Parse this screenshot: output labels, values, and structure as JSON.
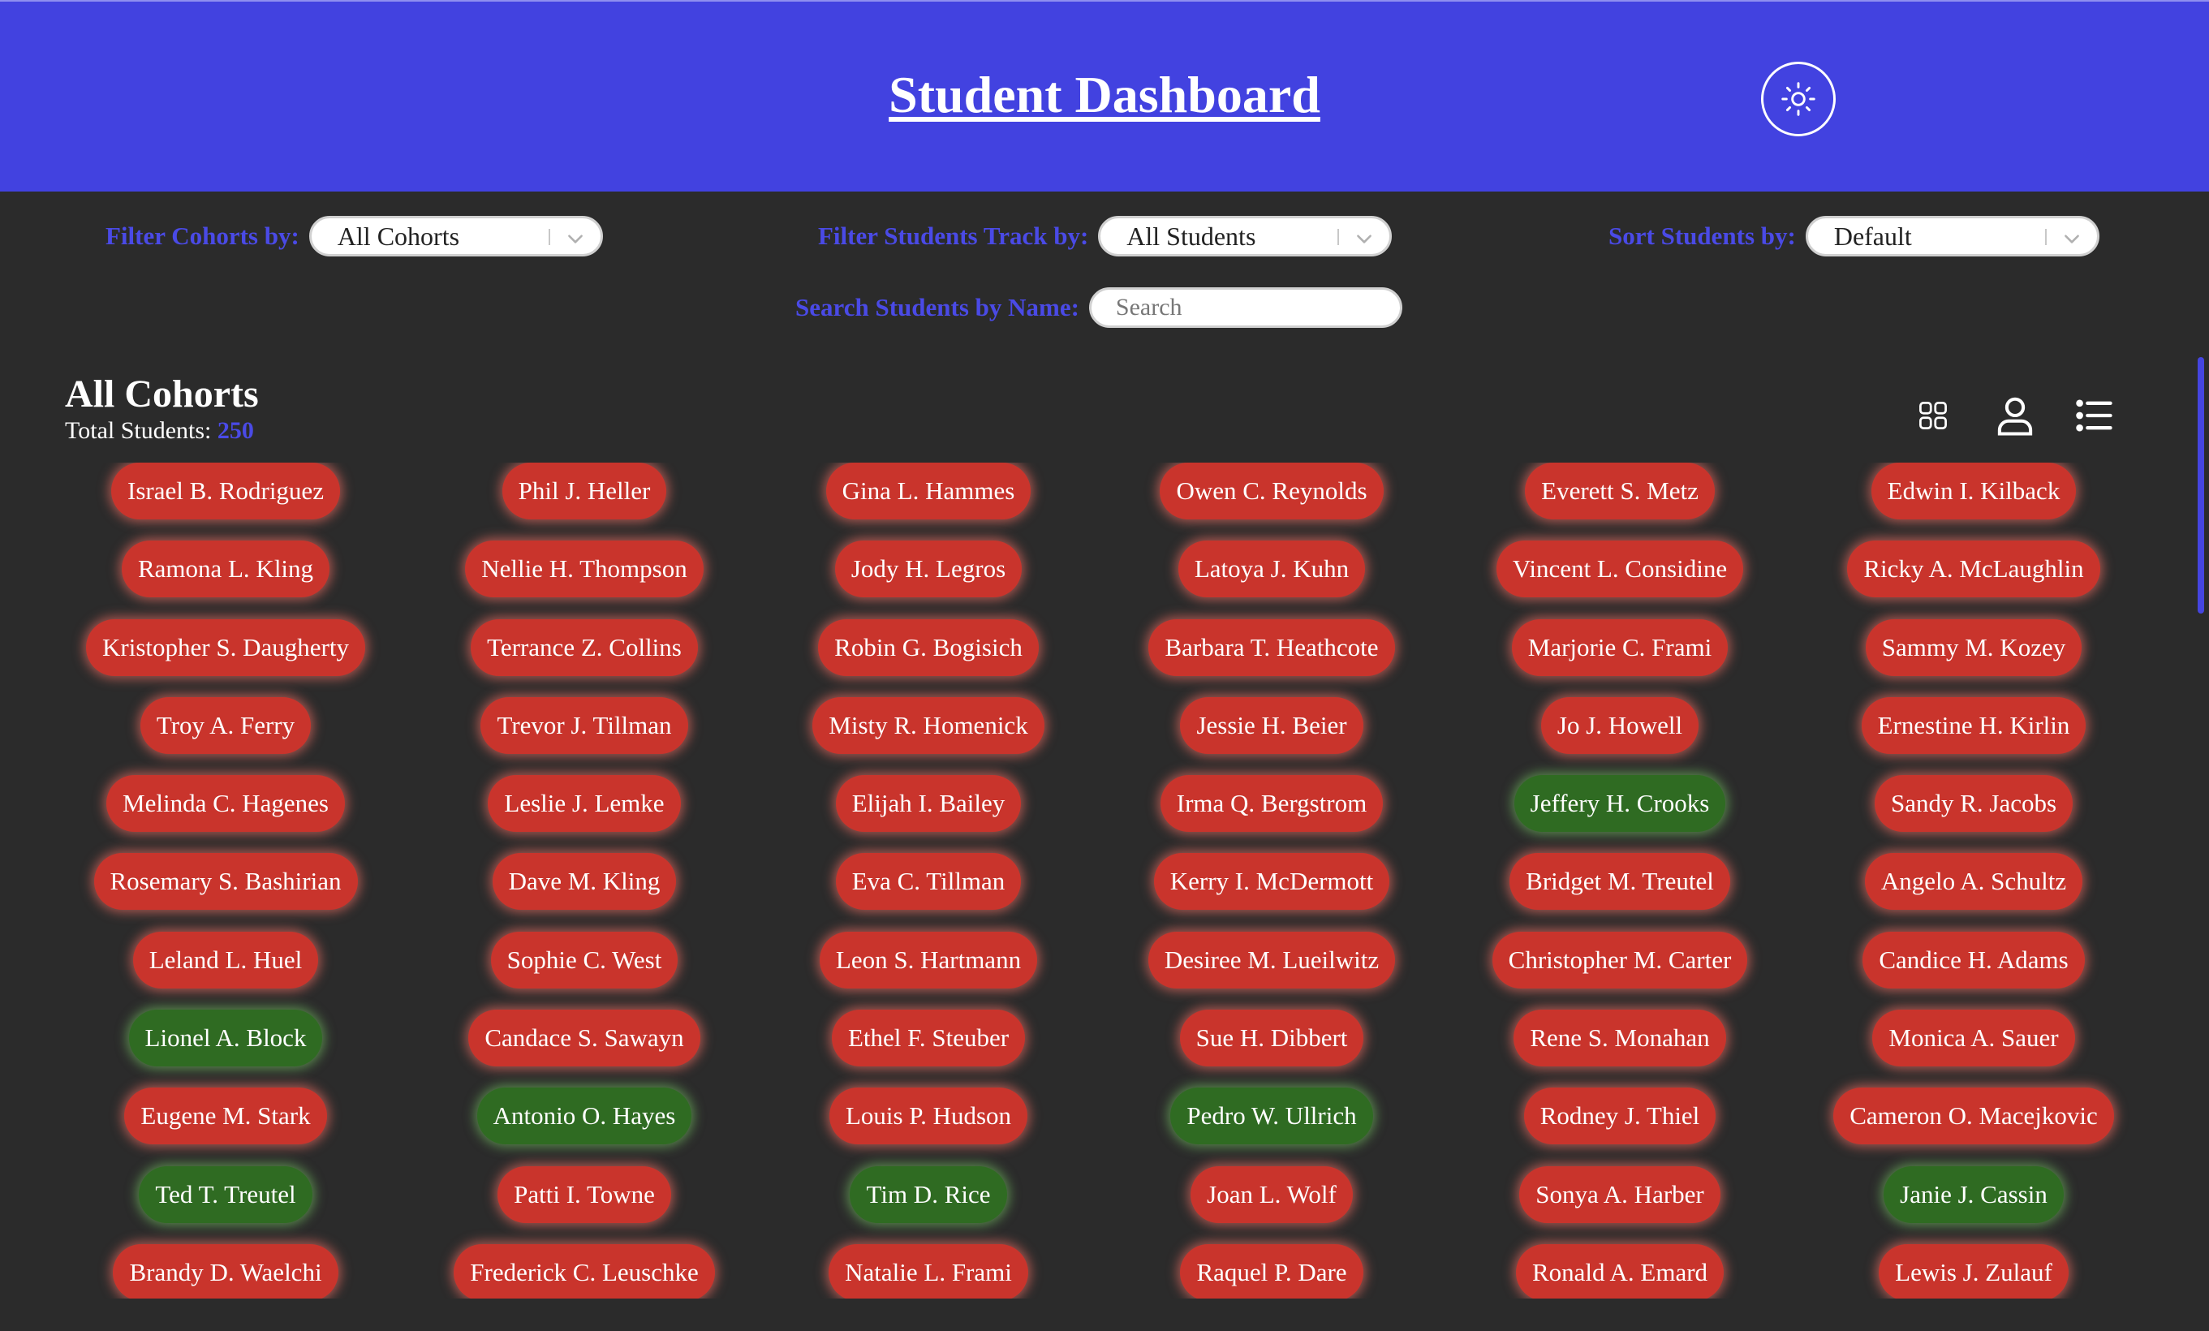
{
  "header": {
    "title": "Student Dashboard",
    "theme_toggle_icon": "sun-icon"
  },
  "filters": {
    "cohorts": {
      "label": "Filter Cohorts by:",
      "value": "All Cohorts"
    },
    "track": {
      "label": "Filter Students Track by:",
      "value": "All Students"
    },
    "sort": {
      "label": "Sort Students by:",
      "value": "Default"
    },
    "search": {
      "label": "Search Students by Name:",
      "placeholder": "Search",
      "value": ""
    }
  },
  "summary": {
    "heading": "All Cohorts",
    "total_label": "Total Students: ",
    "total_count": "250"
  },
  "view_icons": [
    "grid-view-icon",
    "profile-view-icon",
    "list-view-icon"
  ],
  "colors": {
    "header": "#4242e0",
    "background": "#2b2b2b",
    "accent": "#4a4ae6",
    "red_status": "#c9342c",
    "green_status": "#2f6b22"
  },
  "students": {
    "columns": [
      [
        {
          "name": "Israel B. Rodriguez",
          "status": "red"
        },
        {
          "name": "Ramona L. Kling",
          "status": "red"
        },
        {
          "name": "Kristopher S. Daugherty",
          "status": "red"
        },
        {
          "name": "Troy A. Ferry",
          "status": "red"
        },
        {
          "name": "Melinda C. Hagenes",
          "status": "red"
        },
        {
          "name": "Rosemary S. Bashirian",
          "status": "red"
        },
        {
          "name": "Leland L. Huel",
          "status": "red"
        },
        {
          "name": "Lionel A. Block",
          "status": "green"
        },
        {
          "name": "Eugene M. Stark",
          "status": "red"
        },
        {
          "name": "Ted T. Treutel",
          "status": "green"
        },
        {
          "name": "Brandy D. Waelchi",
          "status": "red"
        }
      ],
      [
        {
          "name": "Phil J. Heller",
          "status": "red"
        },
        {
          "name": "Nellie H. Thompson",
          "status": "red"
        },
        {
          "name": "Terrance Z. Collins",
          "status": "red"
        },
        {
          "name": "Trevor J. Tillman",
          "status": "red"
        },
        {
          "name": "Leslie J. Lemke",
          "status": "red"
        },
        {
          "name": "Dave M. Kling",
          "status": "red"
        },
        {
          "name": "Sophie C. West",
          "status": "red"
        },
        {
          "name": "Candace S. Sawayn",
          "status": "red"
        },
        {
          "name": "Antonio O. Hayes",
          "status": "green"
        },
        {
          "name": "Patti I. Towne",
          "status": "red"
        },
        {
          "name": "Frederick C. Leuschke",
          "status": "red"
        }
      ],
      [
        {
          "name": "Gina L. Hammes",
          "status": "red"
        },
        {
          "name": "Jody H. Legros",
          "status": "red"
        },
        {
          "name": "Robin G. Bogisich",
          "status": "red"
        },
        {
          "name": "Misty R. Homenick",
          "status": "red"
        },
        {
          "name": "Elijah I. Bailey",
          "status": "red"
        },
        {
          "name": "Eva C. Tillman",
          "status": "red"
        },
        {
          "name": "Leon S. Hartmann",
          "status": "red"
        },
        {
          "name": "Ethel F. Steuber",
          "status": "red"
        },
        {
          "name": "Louis P. Hudson",
          "status": "red"
        },
        {
          "name": "Tim D. Rice",
          "status": "green"
        },
        {
          "name": "Natalie L. Frami",
          "status": "red"
        }
      ],
      [
        {
          "name": "Owen C. Reynolds",
          "status": "red"
        },
        {
          "name": "Latoya J. Kuhn",
          "status": "red"
        },
        {
          "name": "Barbara T. Heathcote",
          "status": "red"
        },
        {
          "name": "Jessie H. Beier",
          "status": "red"
        },
        {
          "name": "Irma Q. Bergstrom",
          "status": "red"
        },
        {
          "name": "Kerry I. McDermott",
          "status": "red"
        },
        {
          "name": "Desiree M. Lueilwitz",
          "status": "red"
        },
        {
          "name": "Sue H. Dibbert",
          "status": "red"
        },
        {
          "name": "Pedro W. Ullrich",
          "status": "green"
        },
        {
          "name": "Joan L. Wolf",
          "status": "red"
        },
        {
          "name": "Raquel P. Dare",
          "status": "red"
        }
      ],
      [
        {
          "name": "Everett S. Metz",
          "status": "red"
        },
        {
          "name": "Vincent L. Considine",
          "status": "red"
        },
        {
          "name": "Marjorie C. Frami",
          "status": "red"
        },
        {
          "name": "Jo J. Howell",
          "status": "red"
        },
        {
          "name": "Jeffery H. Crooks",
          "status": "green"
        },
        {
          "name": "Bridget M. Treutel",
          "status": "red"
        },
        {
          "name": "Christopher M. Carter",
          "status": "red"
        },
        {
          "name": "Rene S. Monahan",
          "status": "red"
        },
        {
          "name": "Rodney J. Thiel",
          "status": "red"
        },
        {
          "name": "Sonya A. Harber",
          "status": "red"
        },
        {
          "name": "Ronald A. Emard",
          "status": "red"
        }
      ],
      [
        {
          "name": "Edwin I. Kilback",
          "status": "red"
        },
        {
          "name": "Ricky A. McLaughlin",
          "status": "red"
        },
        {
          "name": "Sammy M. Kozey",
          "status": "red"
        },
        {
          "name": "Ernestine H. Kirlin",
          "status": "red"
        },
        {
          "name": "Sandy R. Jacobs",
          "status": "red"
        },
        {
          "name": "Angelo A. Schultz",
          "status": "red"
        },
        {
          "name": "Candice H. Adams",
          "status": "red"
        },
        {
          "name": "Monica A. Sauer",
          "status": "red"
        },
        {
          "name": "Cameron O. Macejkovic",
          "status": "red"
        },
        {
          "name": "Janie J. Cassin",
          "status": "green"
        },
        {
          "name": "Lewis J. Zulauf",
          "status": "red"
        }
      ]
    ]
  }
}
